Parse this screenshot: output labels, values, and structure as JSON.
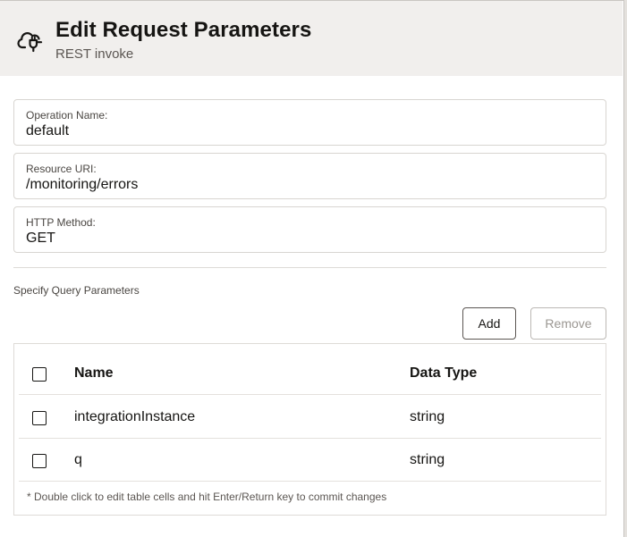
{
  "header": {
    "title": "Edit Request Parameters",
    "subtitle": "REST invoke",
    "icon": "cloud-plug-icon"
  },
  "fields": [
    {
      "label": "Operation Name:",
      "value": "default"
    },
    {
      "label": "Resource URI:",
      "value": "/monitoring/errors"
    },
    {
      "label": "HTTP Method:",
      "value": "GET"
    }
  ],
  "query": {
    "section_label": "Specify Query Parameters",
    "add_label": "Add",
    "remove_label": "Remove",
    "columns": {
      "name": "Name",
      "type": "Data Type"
    },
    "rows": [
      {
        "name": "integrationInstance",
        "type": "string"
      },
      {
        "name": "q",
        "type": "string"
      }
    ],
    "footnote": "* Double click to edit table cells and hit Enter/Return key to commit changes"
  },
  "colors": {
    "header_bg": "#f1efed",
    "text": "#161513",
    "muted": "#5b5652",
    "border": "#d8d5d1",
    "disabled": "#9b9792"
  }
}
